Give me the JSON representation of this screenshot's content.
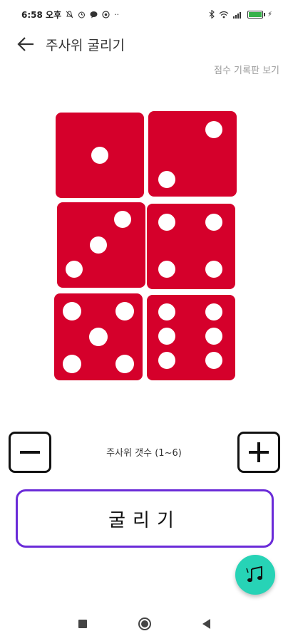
{
  "status_bar": {
    "time": "6:58 오후",
    "icons": [
      "mute-icon",
      "alarm-icon",
      "chat-icon",
      "data-saver-icon",
      "more-icon"
    ],
    "ellipsis": "··",
    "right_icons": [
      "bluetooth-icon",
      "wifi-icon",
      "signal-icon",
      "battery-icon"
    ],
    "battery_percent": 100,
    "battery_label": "100",
    "charging_mark": "⚡"
  },
  "app_bar": {
    "title": "주사위 굴리기",
    "back_icon": "arrow-left-icon"
  },
  "score_link": "점수 기록판 보기",
  "dice": {
    "color": "#d5002b",
    "faces": [
      1,
      2,
      3,
      4,
      5,
      6
    ]
  },
  "stepper": {
    "label": "주사위 갯수 (1~6)",
    "minus": "−",
    "plus": "+",
    "count": 6
  },
  "roll_button": {
    "label": "굴리기",
    "border_color": "#6a2bd8"
  },
  "fab": {
    "icon": "music-notes-icon",
    "color": "#27d3b6"
  },
  "nav_bar": {
    "items": [
      "recents-icon",
      "home-icon",
      "back-icon"
    ]
  }
}
